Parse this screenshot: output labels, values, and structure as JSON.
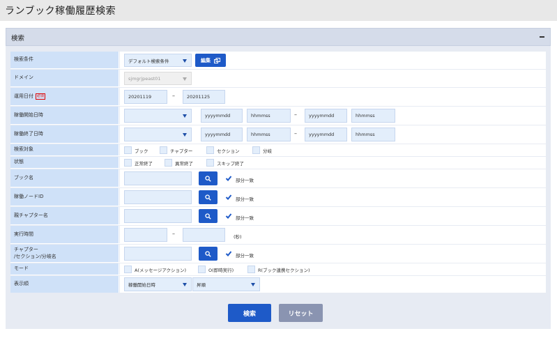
{
  "page": {
    "title": "ランブック稼働履歴検索"
  },
  "panel": {
    "title": "検索",
    "collapse": "–"
  },
  "rows": {
    "condition": {
      "label": "検索条件",
      "select_value": "デフォルト検索条件",
      "edit_button": "編集"
    },
    "domain": {
      "label": "ドメイン",
      "select_value": "sjmgrjpeast01"
    },
    "operation_date": {
      "label": "運用日付",
      "required": "必須",
      "from": "20201119",
      "sep": "–",
      "to": "20201125"
    },
    "start_time": {
      "label": "稼働開始日時",
      "date_from": "yyyymmdd",
      "time_from": "hhmmss",
      "sep": "–",
      "date_to": "yyyymmdd",
      "time_to": "hhmmss"
    },
    "end_time": {
      "label": "稼働終了日時",
      "date_from": "yyyymmdd",
      "time_from": "hhmmss",
      "sep": "–",
      "date_to": "yyyymmdd",
      "time_to": "hhmmss"
    },
    "target": {
      "label": "検索対象",
      "options": [
        "ブック",
        "チャプター",
        "セクション",
        "分岐"
      ]
    },
    "state": {
      "label": "状態",
      "options": [
        "正常終了",
        "異常終了",
        "スキップ終了"
      ]
    },
    "book_name": {
      "label": "ブック名",
      "partial": "部分一致"
    },
    "node_id": {
      "label": "稼働ノードID",
      "partial": "部分一致"
    },
    "parent_chapter": {
      "label": "親チャプター名",
      "partial": "部分一致"
    },
    "exec_time": {
      "label": "実行時間",
      "sep": "–",
      "unit": "(秒)"
    },
    "chapter_name": {
      "label_line1": "チャプター",
      "label_line2": "/セクション/分岐名",
      "partial": "部分一致"
    },
    "mode": {
      "label": "モード",
      "options": [
        "A(メッセージアクション)",
        "O(即時実行)",
        "R(ブック連携セクション)"
      ]
    },
    "order": {
      "label": "表示順",
      "sort_field": "稼働開始日時",
      "sort_dir": "昇順"
    }
  },
  "footer": {
    "search_button": "検索",
    "reset_button": "リセット"
  },
  "colors": {
    "accent": "#1e5ac8",
    "label_bg": "#cfe1f8",
    "input_bg": "#e3eefb",
    "reset": "#8a94b1"
  }
}
